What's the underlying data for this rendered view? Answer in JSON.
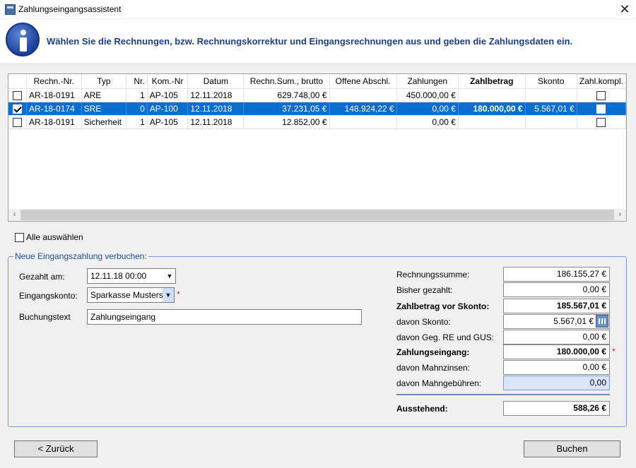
{
  "window": {
    "title": "Zahlungseingangsassistent"
  },
  "banner": {
    "text": "Wählen Sie die Rechnungen, bzw. Rechnungskorrektur und Eingangsrechnungen aus und geben die Zahlungsdaten ein."
  },
  "grid": {
    "columns": [
      "",
      "Rechn.-Nr.",
      "Typ",
      "Nr.",
      "Kom.-Nr",
      "Datum",
      "Rechn.Sum., brutto",
      "Offene Abschl.",
      "Zahlungen",
      "Zahlbetrag",
      "Skonto",
      "Zahl.kompl."
    ],
    "rows": [
      {
        "checked": false,
        "rechnr": "AR-18-0191",
        "typ": "ARE",
        "nr": "1",
        "kom": "AP-105",
        "datum": "12.11.2018",
        "summe": "629.748,00 €",
        "offen": "",
        "zahlungen": "450.000,00 €",
        "zahlbetrag": "",
        "skonto": "",
        "kompl": false
      },
      {
        "checked": true,
        "rechnr": "AR-18-0174",
        "typ": "SRE",
        "nr": "0",
        "kom": "AP-100",
        "datum": "12.11.2018",
        "summe": "37.231,05 €",
        "offen": "148.924,22 €",
        "zahlungen": "0,00 €",
        "zahlbetrag": "180.000,00 €",
        "skonto": "5.567,01 €",
        "kompl": false
      },
      {
        "checked": false,
        "rechnr": "AR-18-0191",
        "typ": "Sicherheit",
        "nr": "1",
        "kom": "AP-105",
        "datum": "12.11.2018",
        "summe": "12.852,00 €",
        "offen": "",
        "zahlungen": "0,00 €",
        "zahlbetrag": "",
        "skonto": "",
        "kompl": false
      }
    ]
  },
  "select_all": {
    "label": "Alle auswählen"
  },
  "form": {
    "legend": "Neue Eingangszahlung verbuchen:",
    "gezahlt_label": "Gezahlt am:",
    "gezahlt_value": "12.11.18 00:00",
    "konto_label": "Eingangskonto:",
    "konto_value": "Sparkasse Musterst",
    "text_label": "Buchungstext",
    "text_value": "Zahlungseingang",
    "required_mark": "*"
  },
  "summary": {
    "rechnungssumme_label": "Rechnungssumme:",
    "rechnungssumme": "186.155,27 €",
    "bisher_label": "Bisher gezahlt:",
    "bisher": "0,00 €",
    "vorskonto_label": "Zahlbetrag vor Skonto:",
    "vorskonto": "185.567,01 €",
    "skonto_label": "davon Skonto:",
    "skonto": "5.567,01 €",
    "geg_label": "davon Geg. RE und GUS:",
    "geg": "0,00 €",
    "eingang_label": "Zahlungseingang:",
    "eingang": "180.000,00 €",
    "zinsen_label": "davon Mahnzinsen:",
    "zinsen": "0,00 €",
    "gebuehren_label": "davon Mahngebühren:",
    "gebuehren": "0,00",
    "aussteh_label": "Ausstehend:",
    "aussteh": "588,26 €"
  },
  "buttons": {
    "back": "< Zurück",
    "book": "Buchen"
  }
}
